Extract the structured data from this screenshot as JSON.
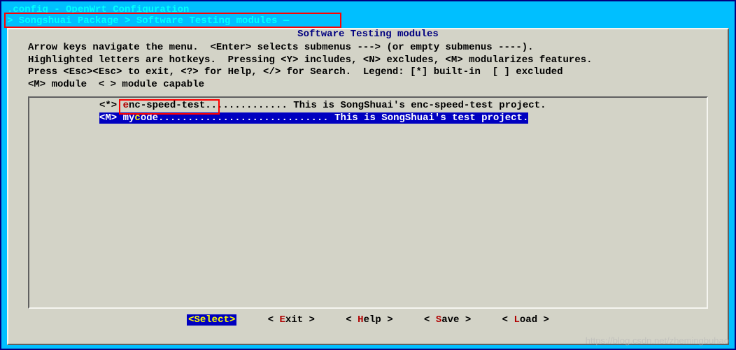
{
  "title": ".config - OpenWrt Configuration",
  "breadcrumb": "> Songshuai Package > Software Testing modules —",
  "panel_title": "Software Testing modules",
  "instructions": {
    "l1": "Arrow keys navigate the menu.  <Enter> selects submenus ---> (or empty submenus ----).",
    "l2": "Highlighted letters are hotkeys.  Pressing <Y> includes, <N> excludes, <M> modularizes features.",
    "l3": "Press <Esc><Esc> to exit, <?> for Help, </> for Search.  Legend: [*] built-in  [ ] excluded",
    "l4": "<M> module  < > module capable"
  },
  "items": [
    {
      "marker": "<*> ",
      "hotkey": "e",
      "label_rest": "nc-speed-test.............. This is SongShuai's enc-speed-test project.",
      "selected": false
    },
    {
      "marker": "<M> ",
      "hotkey_pre": "my",
      "hotkey": "c",
      "label_rest": "ode",
      "dots": "............................. ",
      "desc": "This is SongShuai's test project.",
      "selected": true
    }
  ],
  "buttons": {
    "select": "Select",
    "exit_hk": "E",
    "exit_rest": "xit",
    "help_hk": "H",
    "help_rest": "elp",
    "save_hk": "S",
    "save_rest": "ave",
    "load_hk": "L",
    "load_rest": "oad"
  },
  "watermark": "https://blog.csdn.net/zhemingbuhao"
}
